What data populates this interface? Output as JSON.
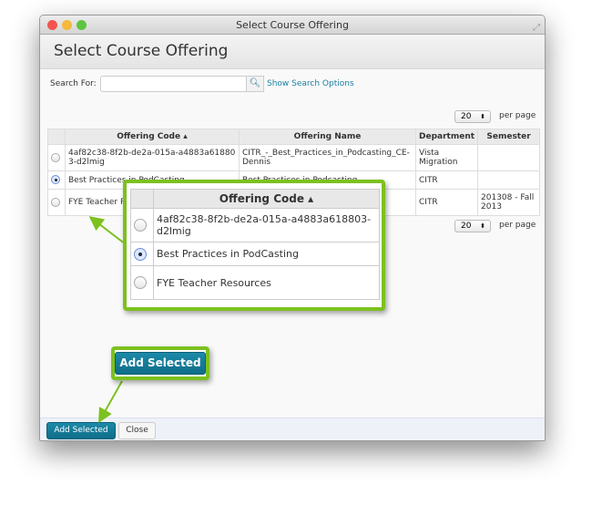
{
  "window": {
    "title": "Select Course Offering"
  },
  "header": {
    "title": "Select Course Offering"
  },
  "search": {
    "label": "Search For:",
    "value": "",
    "show_options": "Show Search Options"
  },
  "pager": {
    "per_page_value": "20",
    "per_page_label": "per page"
  },
  "table": {
    "columns": [
      "Offering Code ▴",
      "Offering Name",
      "Department",
      "Semester"
    ],
    "rows": [
      {
        "code": "4af82c38-8f2b-de2a-015a-a4883a618803-d2lmig",
        "name": "CITR_-_Best_Practices_in_Podcasting_CE-Dennis",
        "department": "Vista Migration",
        "semester": "",
        "selected": false
      },
      {
        "code": "Best Practices in PodCasting",
        "name": "Best Practices in Podcasting",
        "department": "CITR",
        "semester": "",
        "selected": true
      },
      {
        "code": "FYE Teacher Resources",
        "name": "",
        "department": "CITR",
        "semester": "201308 - Fall 2013",
        "selected": false
      }
    ]
  },
  "callout": {
    "header": "Offering Code ▴",
    "rows": [
      "4af82c38-8f2b-de2a-015a-a4883a618803-d2lmig",
      "Best Practices in PodCasting",
      "FYE Teacher Resources"
    ]
  },
  "footer": {
    "add_selected": "Add Selected",
    "close": "Close"
  },
  "colors": {
    "accent": "#1b7fa3",
    "highlight": "#7cc11e",
    "button": "#147c99"
  }
}
